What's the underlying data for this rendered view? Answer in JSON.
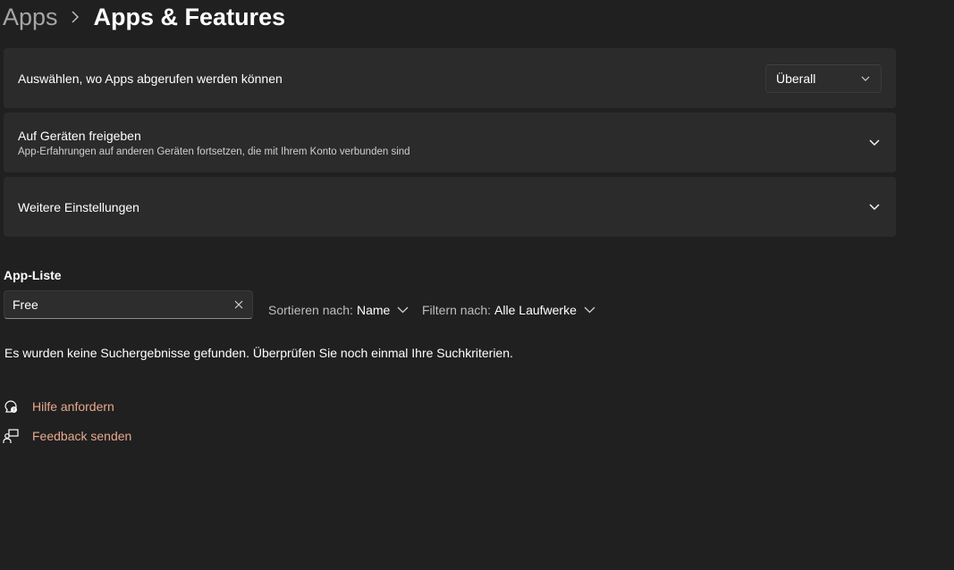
{
  "breadcrumb": {
    "parent": "Apps",
    "current": "Apps & Features"
  },
  "cards": {
    "install_source": {
      "title": "Auswählen, wo Apps abgerufen werden können",
      "dropdown_value": "Überall"
    },
    "share_devices": {
      "title": "Auf Geräten freigeben",
      "subtitle": "App-Erfahrungen auf anderen Geräten fortsetzen, die mit Ihrem Konto verbunden sind"
    },
    "more_settings": {
      "title": "Weitere Einstellungen"
    }
  },
  "app_list": {
    "title": "App-Liste",
    "search_value": "Free",
    "sort_label": "Sortieren nach:",
    "sort_value": "Name",
    "filter_label": "Filtern nach:",
    "filter_value": "Alle Laufwerke",
    "no_results": "Es wurden keine Suchergebnisse gefunden. Überprüfen Sie noch einmal Ihre Suchkriterien."
  },
  "links": {
    "help": "Hilfe anfordern",
    "feedback": "Feedback senden"
  },
  "icons": {
    "breadcrumb_sep": "chevron-right-icon",
    "dropdown": "chevron-down-icon",
    "expand": "chevron-down-icon",
    "clear": "close-icon",
    "help": "help-chat-icon",
    "feedback": "feedback-icon"
  },
  "colors": {
    "background": "#202020",
    "card": "#2b2b2b",
    "link": "#e8a88e"
  }
}
